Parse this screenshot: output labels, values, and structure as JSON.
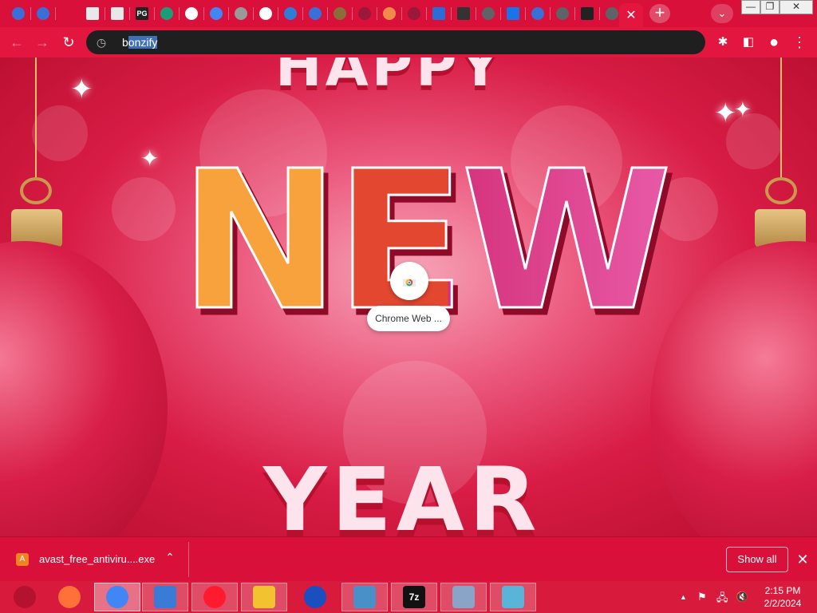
{
  "browser": {
    "tabs": [
      {
        "icon": "globe-icon",
        "color": "#3a6fd8"
      },
      {
        "icon": "globe-icon",
        "color": "#3a6fd8"
      },
      {
        "icon": "page-icon",
        "color": "#e8e8e8"
      },
      {
        "icon": "page-icon",
        "color": "#e8e8e8"
      },
      {
        "icon": "pg-logo-icon",
        "color": "#222222",
        "label": "PG"
      },
      {
        "icon": "edge-icon",
        "color": "#1b9e77"
      },
      {
        "icon": "google-icon",
        "color": "#ffffff"
      },
      {
        "icon": "search-site-icon",
        "color": "#4285f4"
      },
      {
        "icon": "cloud-icon",
        "color": "#999999"
      },
      {
        "icon": "google-icon",
        "color": "#ffffff"
      },
      {
        "icon": "leaf-icon",
        "color": "#2e7dd7"
      },
      {
        "icon": "globe-icon",
        "color": "#3a6fd8"
      },
      {
        "icon": "bookshelf-icon",
        "color": "#8b6d3a"
      },
      {
        "icon": "robot-icon",
        "color": "#9a1838"
      },
      {
        "icon": "avatar-icon",
        "color": "#f08a4b"
      },
      {
        "icon": "robot-icon",
        "color": "#9a1838"
      },
      {
        "icon": "app-window-icon",
        "color": "#2d6bd6"
      },
      {
        "icon": "book-icon",
        "color": "#333333"
      },
      {
        "icon": "search-icon",
        "color": "#5f6368"
      },
      {
        "icon": "plus-box-icon",
        "color": "#1a73e8"
      },
      {
        "icon": "globe-icon",
        "color": "#3a6fd8"
      },
      {
        "icon": "search-icon",
        "color": "#5f6368"
      },
      {
        "icon": "museum-icon",
        "color": "#222222"
      },
      {
        "icon": "search-icon",
        "color": "#5f6368"
      }
    ],
    "active_tab_close": "✕",
    "new_tab": "+",
    "tab_search": "⌄",
    "window_controls": {
      "minimize": "—",
      "restore": "❐",
      "close": "✕"
    },
    "toolbar": {
      "back": "←",
      "forward": "→",
      "reload": "↻",
      "omnibox_icon": "◷",
      "omnibox_text_prefix": "b",
      "omnibox_text_selected": "onzify",
      "extensions": "✱",
      "side_panel": "◧",
      "profile": "●",
      "menu": "⋮"
    }
  },
  "content": {
    "theme": "Happy New Year wallpaper",
    "art_words": [
      "HAPPY",
      "NEW",
      "YEAR"
    ],
    "shortcut_label": "Chrome Web ...",
    "shortcut_icon": "chrome-web-store-icon"
  },
  "downloads": {
    "file_name": "avast_free_antiviru....exe",
    "file_icon": "avast-icon",
    "chevron": "⌃",
    "show_all": "Show all",
    "close": "✕"
  },
  "taskbar": {
    "apps": [
      {
        "name": "start",
        "icon": "ornament-start-icon",
        "color": "#b5122f"
      },
      {
        "name": "firefox",
        "icon": "firefox-icon",
        "color": "#ff7139"
      },
      {
        "name": "chrome",
        "icon": "chrome-icon",
        "color": "#4285f4"
      },
      {
        "name": "control-panel",
        "icon": "control-panel-icon",
        "color": "#3a7bd5"
      },
      {
        "name": "opera",
        "icon": "opera-icon",
        "color": "#ff1b2d"
      },
      {
        "name": "file-explorer",
        "icon": "folder-icon",
        "color": "#f2c230"
      },
      {
        "name": "malwarebytes",
        "icon": "malwarebytes-icon",
        "color": "#1a4fbf"
      },
      {
        "name": "photos",
        "icon": "photo-icon",
        "color": "#4a90c8"
      },
      {
        "name": "7zip",
        "icon": "7zip-icon",
        "color": "#111111",
        "label": "7z"
      },
      {
        "name": "system-monitor",
        "icon": "monitor-icon",
        "color": "#8aa4c8"
      },
      {
        "name": "notepad",
        "icon": "notepad-icon",
        "color": "#5ab4d8"
      }
    ],
    "tray": {
      "chevron": "▲",
      "flag": "⚑",
      "network": "🖧",
      "volume": "🔇"
    },
    "clock": {
      "time": "2:15 PM",
      "date": "2/2/2024"
    }
  }
}
